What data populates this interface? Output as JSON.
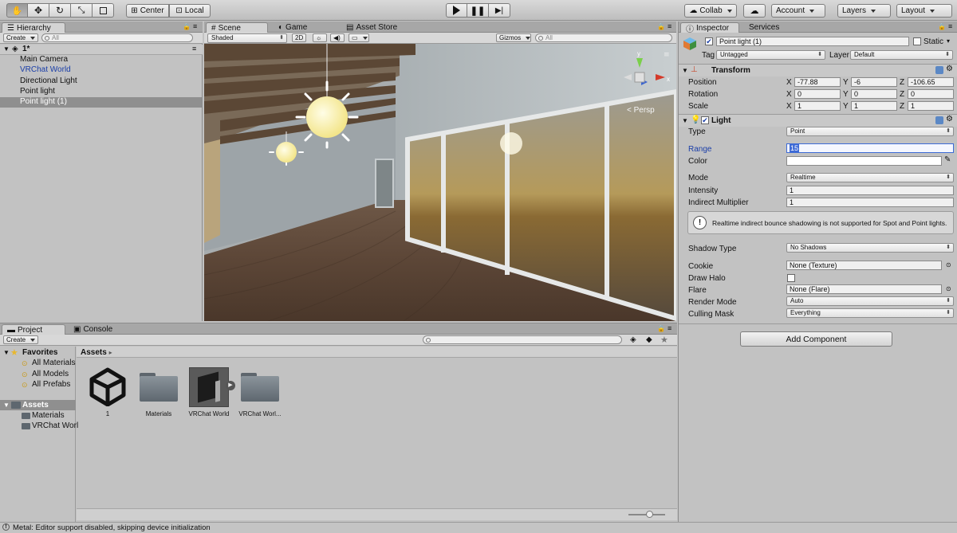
{
  "toolbar": {
    "tools": [
      "hand",
      "move",
      "rotate",
      "scale",
      "rect"
    ],
    "pivot": "Center",
    "space": "Local",
    "collab": "Collab",
    "account": "Account",
    "layers": "Layers",
    "layout": "Layout"
  },
  "hierarchy": {
    "tab": "Hierarchy",
    "create": "Create",
    "search_placeholder": "All",
    "scene_name": "1*",
    "items": [
      "Main Camera",
      "VRChat World",
      "Directional Light",
      "Point light",
      "Point light (1)"
    ]
  },
  "scene": {
    "tabs": [
      "Scene",
      "Game",
      "Asset Store"
    ],
    "shading": "Shaded",
    "mode2d": "2D",
    "gizmos": "Gizmos",
    "search_placeholder": "All",
    "persp": "< Persp",
    "gizmo_axes": [
      "y",
      "x"
    ]
  },
  "project": {
    "tabs": [
      "Project",
      "Console"
    ],
    "create": "Create",
    "favorites_title": "Favorites",
    "favorites": [
      "All Materials",
      "All Models",
      "All Prefabs"
    ],
    "assets_title": "Assets",
    "asset_folders": [
      "Materials",
      "VRChat Worl"
    ],
    "breadcrumb": "Assets",
    "assets": [
      {
        "label": "1",
        "kind": "unity-scene"
      },
      {
        "label": "Materials",
        "kind": "folder"
      },
      {
        "label": "VRChat World",
        "kind": "prefab"
      },
      {
        "label": "VRChat Worl...",
        "kind": "folder"
      }
    ]
  },
  "inspector": {
    "tabs": [
      "Inspector",
      "Services"
    ],
    "object_name": "Point light (1)",
    "static_label": "Static",
    "tag_label": "Tag",
    "tag_value": "Untagged",
    "layer_label": "Layer",
    "layer_value": "Default",
    "transform": {
      "title": "Transform",
      "rows": [
        {
          "label": "Position",
          "x": "-77.88",
          "y": "-6",
          "z": "-106.65"
        },
        {
          "label": "Rotation",
          "x": "0",
          "y": "0",
          "z": "0"
        },
        {
          "label": "Scale",
          "x": "1",
          "y": "1",
          "z": "1"
        }
      ]
    },
    "light": {
      "title": "Light",
      "type_label": "Type",
      "type_value": "Point",
      "range_label": "Range",
      "range_value": "15",
      "color_label": "Color",
      "mode_label": "Mode",
      "mode_value": "Realtime",
      "intensity_label": "Intensity",
      "intensity_value": "1",
      "indirect_label": "Indirect Multiplier",
      "indirect_value": "1",
      "warning": "Realtime indirect bounce shadowing is not supported for Spot and Point lights.",
      "shadow_label": "Shadow Type",
      "shadow_value": "No Shadows",
      "cookie_label": "Cookie",
      "cookie_value": "None (Texture)",
      "halo_label": "Draw Halo",
      "flare_label": "Flare",
      "flare_value": "None (Flare)",
      "render_label": "Render Mode",
      "render_value": "Auto",
      "culling_label": "Culling Mask",
      "culling_value": "Everything"
    },
    "add_component": "Add Component"
  },
  "status": {
    "message": "Metal: Editor support disabled, skipping device initialization"
  },
  "colors": {
    "selection": "#8f8f8f",
    "link_blue": "#1a3ea8",
    "panel_bg": "#c2c2c2"
  }
}
